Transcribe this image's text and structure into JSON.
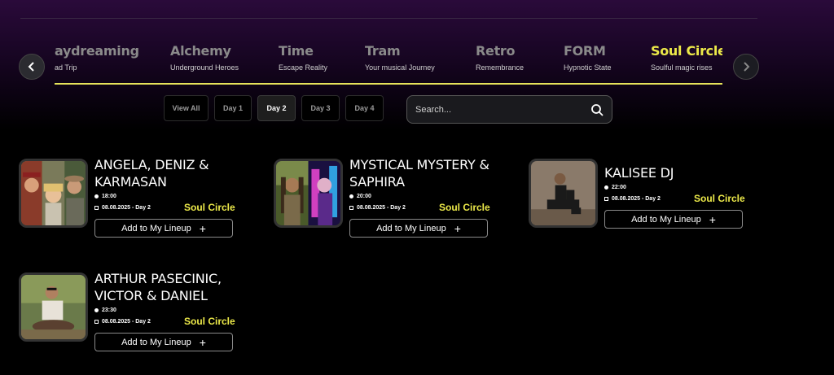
{
  "stages": [
    {
      "name": "aydreaming",
      "subtitle": "ad Trip",
      "active": false
    },
    {
      "name": "Alchemy",
      "subtitle": "Underground Heroes",
      "active": false
    },
    {
      "name": "Time",
      "subtitle": "Escape Reality",
      "active": false
    },
    {
      "name": "Tram",
      "subtitle": "Your musical Journey",
      "active": false
    },
    {
      "name": "Retro",
      "subtitle": "Remembrance",
      "active": false
    },
    {
      "name": "FORM",
      "subtitle": "Hypnotic State",
      "active": false
    },
    {
      "name": "Soul Circle",
      "subtitle": "Soulful magic rises",
      "active": true
    }
  ],
  "days": [
    {
      "label": "View All",
      "active": false
    },
    {
      "label": "Day 1",
      "active": false
    },
    {
      "label": "Day 2",
      "active": true
    },
    {
      "label": "Day 3",
      "active": false
    },
    {
      "label": "Day 4",
      "active": false
    }
  ],
  "search": {
    "placeholder": "Search..."
  },
  "add_label": "Add to My Lineup",
  "add_icon": "plus",
  "artists": [
    {
      "name": "ANGELA, DENIZ & KARMASAN",
      "time": "18:00",
      "date": "08.08.2025 - Day 2",
      "stage": "Soul Circle",
      "photo": "group-photo"
    },
    {
      "name": "MYSTICAL MYSTERY & SAPHIRA",
      "time": "20:00",
      "date": "08.08.2025 - Day 2",
      "stage": "Soul Circle",
      "photo": "duo-photo"
    },
    {
      "name": "KALISEE DJ",
      "time": "22:00",
      "date": "08.08.2025 - Day 2",
      "stage": "Soul Circle",
      "photo": "portrait-photo"
    },
    {
      "name": "ARTHUR PASECINIC, VICTOR & DANIEL",
      "time": "23:30",
      "date": "08.08.2025 - Day 2",
      "stage": "Soul Circle",
      "photo": "handpan-photo"
    }
  ],
  "colors": {
    "accent": "#ece949",
    "background": "#000000",
    "header_gradient_top": "#2a0a3a"
  }
}
